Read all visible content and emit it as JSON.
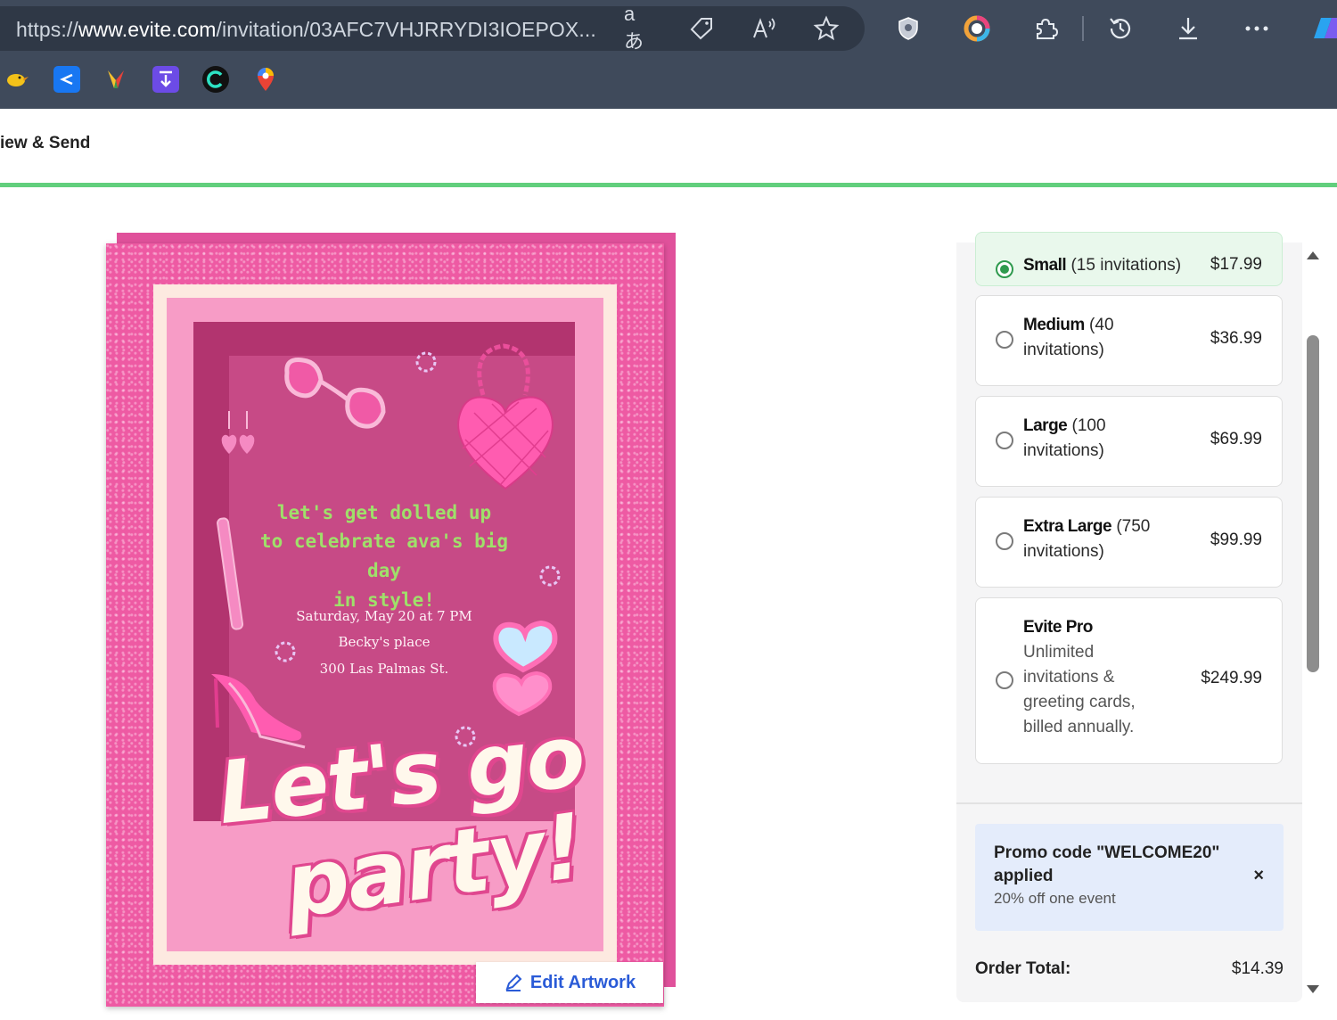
{
  "browser": {
    "url_prefix": "https://",
    "url_host": "www.evite.com",
    "url_path": "/invitation/03AFC7VHJRRYDI3IOEPOX...",
    "read_aloud_label": "aあ",
    "toolbar_icons": [
      "translate-icon",
      "tag-icon",
      "read-aloud-icon",
      "favorite-star-icon",
      "shield-extension-icon",
      "color-extension-icon",
      "extensions-puzzle-icon",
      "history-icon",
      "download-icon",
      "more-menu-icon",
      "copilot-icon"
    ],
    "bookmarks": [
      "bookmark-bird",
      "bookmark-share",
      "bookmark-colorful",
      "bookmark-download",
      "bookmark-c",
      "bookmark-maps"
    ]
  },
  "header": {
    "step_title": "iew & Send",
    "progress_color": "#62cf7d"
  },
  "card": {
    "line1": "let's get dolled up",
    "line2": "to celebrate ava's big",
    "line3": "day",
    "line4": "in style!",
    "date": "Saturday, May 20 at 7 PM",
    "place": "Becky's place",
    "address": "300 Las Palmas St.",
    "big1": "Let's go",
    "big2": "party!",
    "edit_label": "Edit Artwork"
  },
  "options": [
    {
      "name": "Small",
      "detail": " (15 invitations)",
      "price": "$17.99",
      "selected": true
    },
    {
      "name": "Medium",
      "detail": " (40",
      "detail2": "invitations)",
      "price": "$36.99",
      "selected": false
    },
    {
      "name": "Large",
      "detail": " (100",
      "detail2": "invitations)",
      "price": "$69.99",
      "selected": false
    },
    {
      "name": "Extra Large",
      "detail": " (750",
      "detail2": "invitations)",
      "price": "$99.99",
      "selected": false
    },
    {
      "name": "Evite Pro",
      "l1": "Unlimited",
      "l2": "invitations &",
      "l3": "greeting cards,",
      "l4": "billed annually.",
      "price": "$249.99",
      "selected": false
    }
  ],
  "promo": {
    "title": "Promo code \"WELCOME20\" applied",
    "subtitle": "20% off one event",
    "close": "×"
  },
  "order": {
    "label": "Order Total:",
    "value": "$14.39"
  }
}
